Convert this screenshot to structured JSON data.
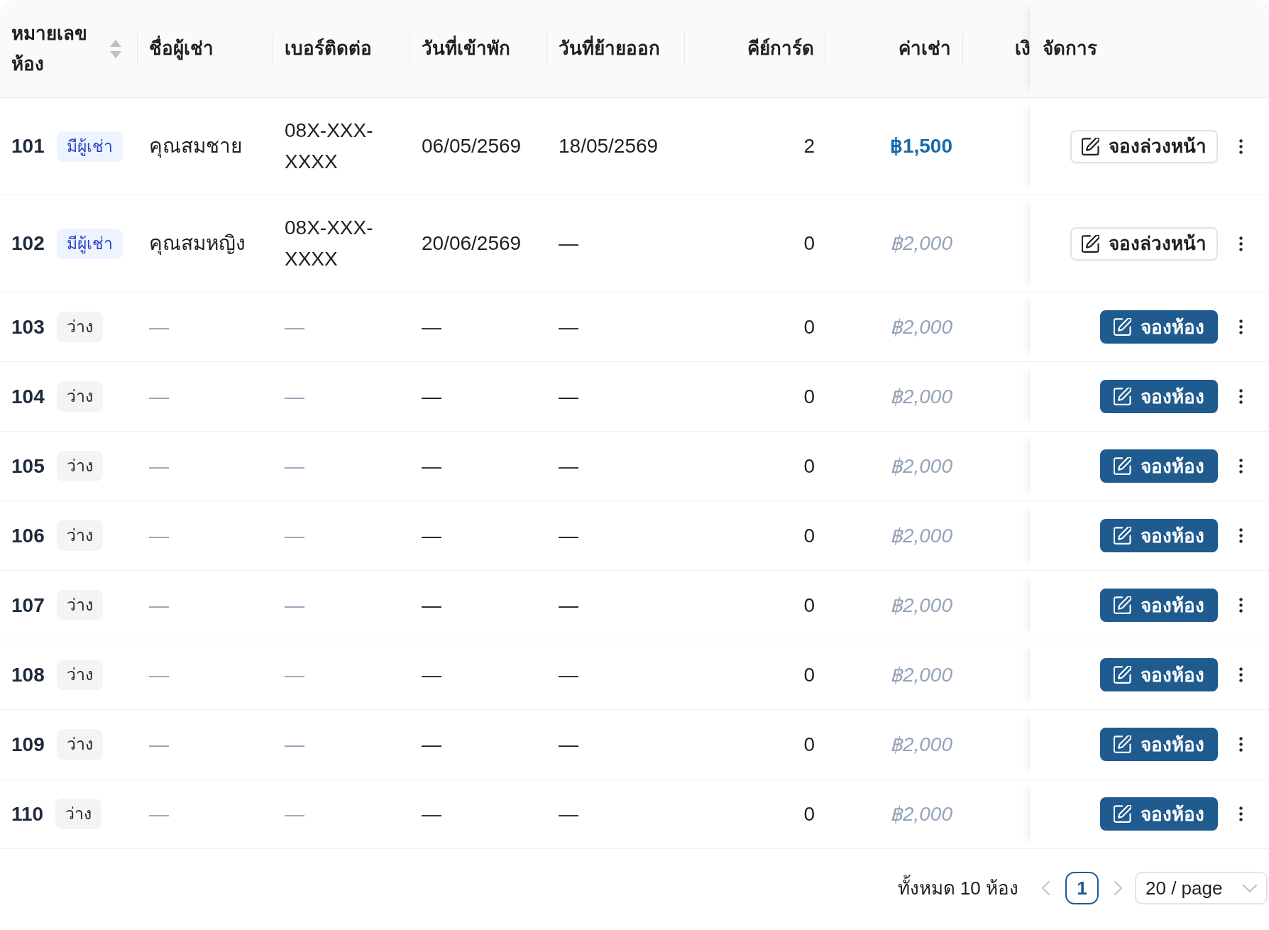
{
  "table": {
    "columns": [
      {
        "label": "หมายเลขห้อง",
        "sortable": true
      },
      {
        "label": "ชื่อผู้เช่า",
        "sortable": false
      },
      {
        "label": "เบอร์ติดต่อ",
        "sortable": false
      },
      {
        "label": "วันที่เข้าพัก",
        "sortable": false
      },
      {
        "label": "วันที่ย้ายออก",
        "sortable": false
      },
      {
        "label": "คีย์การ์ด",
        "sortable": false
      },
      {
        "label": "ค่าเช่า",
        "sortable": false
      },
      {
        "label": "เงิ",
        "sortable": false
      },
      {
        "label": "จัดการ",
        "sortable": false
      }
    ],
    "rows": [
      {
        "room": "101",
        "status": {
          "label": "มีผู้เช่า",
          "kind": "occupied"
        },
        "tenant": {
          "text": "คุณสมชาย",
          "muted": false
        },
        "phone": {
          "text": "08X-XXX-XXXX",
          "muted": false
        },
        "check_in": "06/05/2569",
        "check_out": "18/05/2569",
        "keycards": "2",
        "rent": {
          "text": "฿1,500",
          "muted": false
        },
        "action": {
          "label": "จองล่วงหน้า",
          "kind": "outline"
        }
      },
      {
        "room": "102",
        "status": {
          "label": "มีผู้เช่า",
          "kind": "occupied"
        },
        "tenant": {
          "text": "คุณสมหญิง",
          "muted": false
        },
        "phone": {
          "text": "08X-XXX-XXXX",
          "muted": false
        },
        "check_in": "20/06/2569",
        "check_out": "—",
        "keycards": "0",
        "rent": {
          "text": "฿2,000",
          "muted": true
        },
        "action": {
          "label": "จองล่วงหน้า",
          "kind": "outline"
        }
      },
      {
        "room": "103",
        "status": {
          "label": "ว่าง",
          "kind": "vacant"
        },
        "tenant": {
          "text": "—",
          "muted": true
        },
        "phone": {
          "text": "—",
          "muted": true
        },
        "check_in": "—",
        "check_out": "—",
        "keycards": "0",
        "rent": {
          "text": "฿2,000",
          "muted": true
        },
        "action": {
          "label": "จองห้อง",
          "kind": "primary"
        }
      },
      {
        "room": "104",
        "status": {
          "label": "ว่าง",
          "kind": "vacant"
        },
        "tenant": {
          "text": "—",
          "muted": true
        },
        "phone": {
          "text": "—",
          "muted": true
        },
        "check_in": "—",
        "check_out": "—",
        "keycards": "0",
        "rent": {
          "text": "฿2,000",
          "muted": true
        },
        "action": {
          "label": "จองห้อง",
          "kind": "primary"
        }
      },
      {
        "room": "105",
        "status": {
          "label": "ว่าง",
          "kind": "vacant"
        },
        "tenant": {
          "text": "—",
          "muted": true
        },
        "phone": {
          "text": "—",
          "muted": true
        },
        "check_in": "—",
        "check_out": "—",
        "keycards": "0",
        "rent": {
          "text": "฿2,000",
          "muted": true
        },
        "action": {
          "label": "จองห้อง",
          "kind": "primary"
        }
      },
      {
        "room": "106",
        "status": {
          "label": "ว่าง",
          "kind": "vacant"
        },
        "tenant": {
          "text": "—",
          "muted": true
        },
        "phone": {
          "text": "—",
          "muted": true
        },
        "check_in": "—",
        "check_out": "—",
        "keycards": "0",
        "rent": {
          "text": "฿2,000",
          "muted": true
        },
        "action": {
          "label": "จองห้อง",
          "kind": "primary"
        }
      },
      {
        "room": "107",
        "status": {
          "label": "ว่าง",
          "kind": "vacant"
        },
        "tenant": {
          "text": "—",
          "muted": true
        },
        "phone": {
          "text": "—",
          "muted": true
        },
        "check_in": "—",
        "check_out": "—",
        "keycards": "0",
        "rent": {
          "text": "฿2,000",
          "muted": true
        },
        "action": {
          "label": "จองห้อง",
          "kind": "primary"
        }
      },
      {
        "room": "108",
        "status": {
          "label": "ว่าง",
          "kind": "vacant"
        },
        "tenant": {
          "text": "—",
          "muted": true
        },
        "phone": {
          "text": "—",
          "muted": true
        },
        "check_in": "—",
        "check_out": "—",
        "keycards": "0",
        "rent": {
          "text": "฿2,000",
          "muted": true
        },
        "action": {
          "label": "จองห้อง",
          "kind": "primary"
        }
      },
      {
        "room": "109",
        "status": {
          "label": "ว่าง",
          "kind": "vacant"
        },
        "tenant": {
          "text": "—",
          "muted": true
        },
        "phone": {
          "text": "—",
          "muted": true
        },
        "check_in": "—",
        "check_out": "—",
        "keycards": "0",
        "rent": {
          "text": "฿2,000",
          "muted": true
        },
        "action": {
          "label": "จองห้อง",
          "kind": "primary"
        }
      },
      {
        "room": "110",
        "status": {
          "label": "ว่าง",
          "kind": "vacant"
        },
        "tenant": {
          "text": "—",
          "muted": true
        },
        "phone": {
          "text": "—",
          "muted": true
        },
        "check_in": "—",
        "check_out": "—",
        "keycards": "0",
        "rent": {
          "text": "฿2,000",
          "muted": true
        },
        "action": {
          "label": "จองห้อง",
          "kind": "primary"
        }
      }
    ]
  },
  "pagination": {
    "summary": "ทั้งหมด 10 ห้อง",
    "prev": {
      "disabled": true
    },
    "pages": [
      {
        "label": "1",
        "selected": true
      }
    ],
    "next": {
      "disabled": true
    },
    "page_size": "20 / page"
  }
}
